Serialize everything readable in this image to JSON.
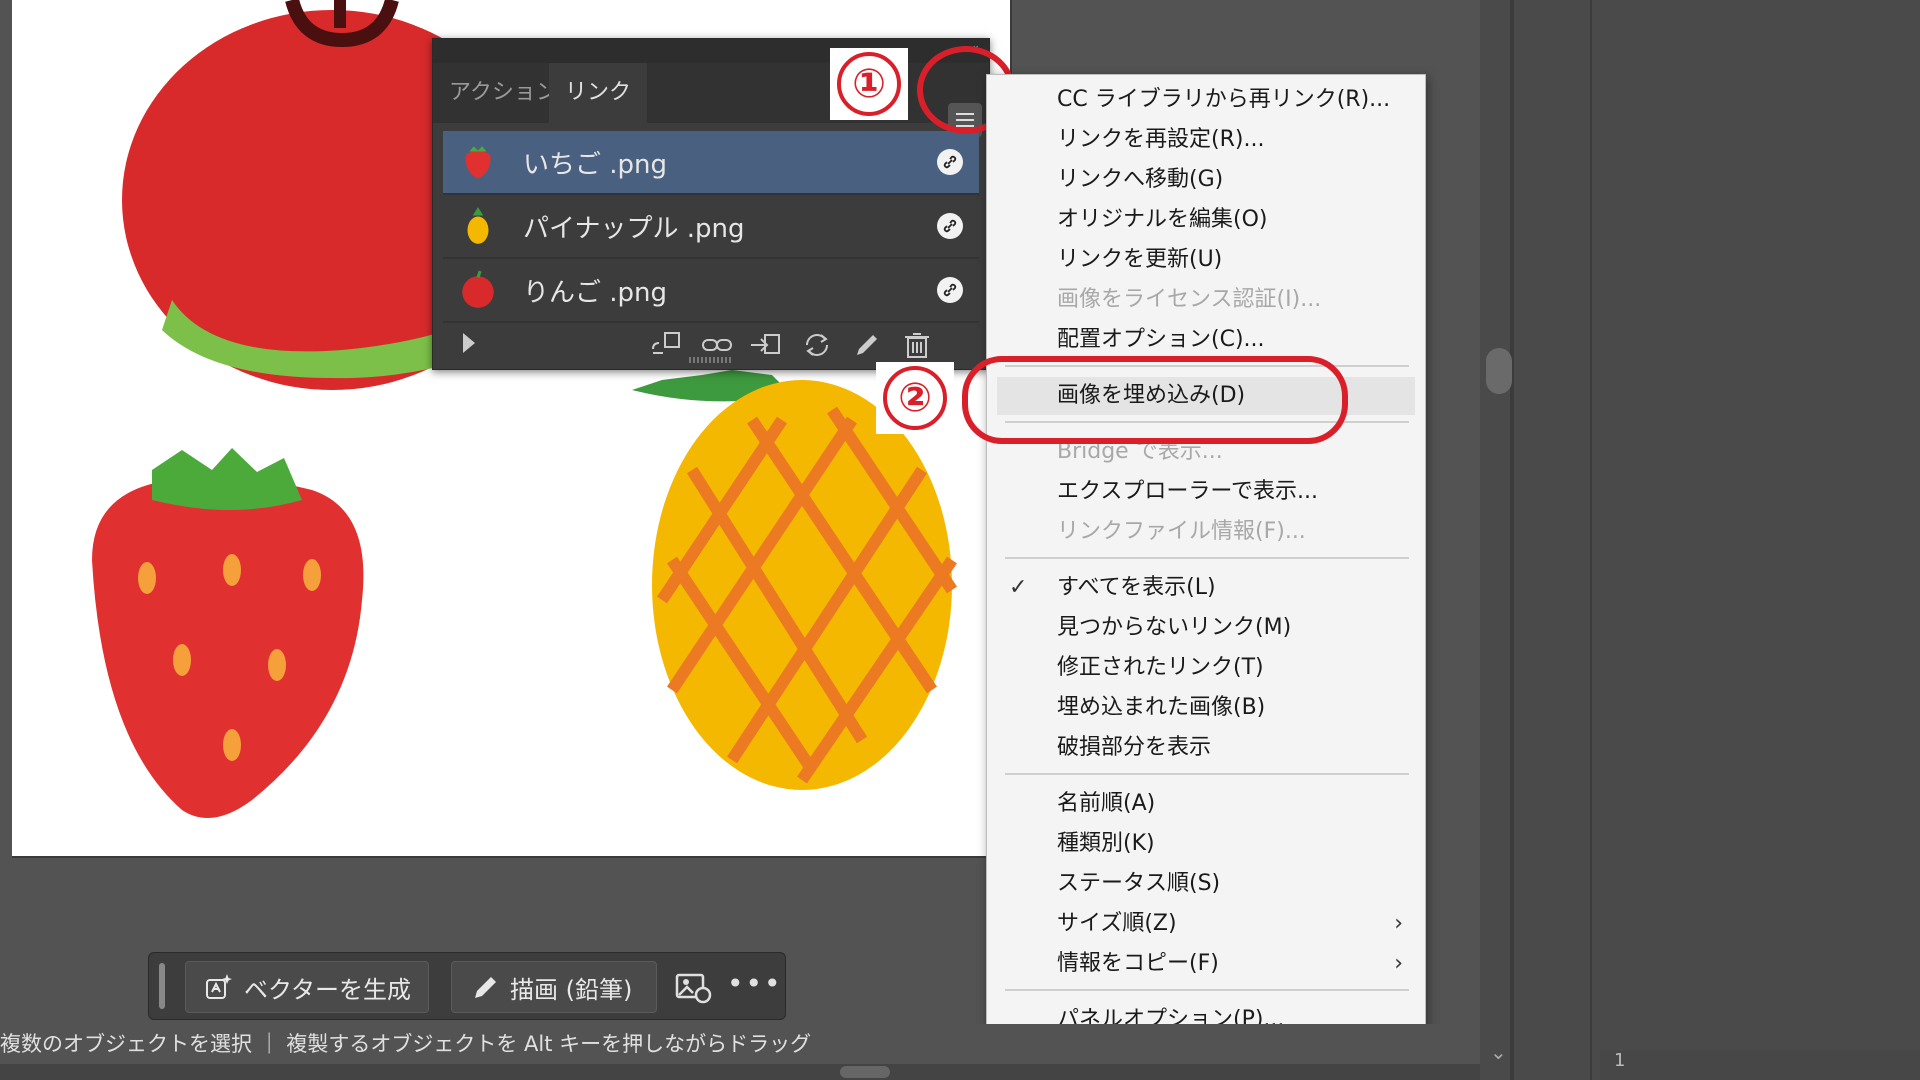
{
  "links_panel": {
    "tabs": [
      {
        "label": "アクション"
      },
      {
        "label": "リンク"
      }
    ],
    "links": [
      {
        "name": "いちご .png"
      },
      {
        "name": "パイナップル .png"
      },
      {
        "name": "りんご .png"
      }
    ]
  },
  "callouts": {
    "one": "①",
    "two": "②"
  },
  "context_menu": {
    "items": [
      {
        "label": "CC ライブラリから再リンク(R)..."
      },
      {
        "label": "リンクを再設定(R)..."
      },
      {
        "label": "リンクへ移動(G)"
      },
      {
        "label": "オリジナルを編集(O)"
      },
      {
        "label": "リンクを更新(U)"
      },
      {
        "label": "画像をライセンス認証(I)..."
      },
      {
        "label": "配置オプション(C)..."
      },
      {
        "label": "画像を埋め込み(D)"
      },
      {
        "label": "Bridge で表示..."
      },
      {
        "label": "エクスプローラーで表示..."
      },
      {
        "label": "リンクファイル情報(F)..."
      },
      {
        "label": "すべてを表示(L)"
      },
      {
        "label": "見つからないリンク(M)"
      },
      {
        "label": "修正されたリンク(T)"
      },
      {
        "label": "埋め込まれた画像(B)"
      },
      {
        "label": "破損部分を表示"
      },
      {
        "label": "名前順(A)"
      },
      {
        "label": "種類別(K)"
      },
      {
        "label": "ステータス順(S)"
      },
      {
        "label": "サイズ順(Z)"
      },
      {
        "label": "情報をコピー(F)"
      },
      {
        "label": "パネルオプション(P)..."
      }
    ],
    "check_mark": "✓",
    "submenu_arrow": "›"
  },
  "context_toolbar": {
    "generate_vector_label": "ベクターを生成",
    "draw_pencil_label": "描画 (鉛筆)",
    "more_label": "•••"
  },
  "status_bar": {
    "text": "複数のオブジェクトを選択 ｜ 複製するオブジェクトを Alt キーを押しながらドラッグ"
  },
  "bottom_strip": {
    "page_number": "1"
  },
  "colors": {
    "annotation_red": "#d9202a",
    "selection_blue": "#4a6080"
  }
}
